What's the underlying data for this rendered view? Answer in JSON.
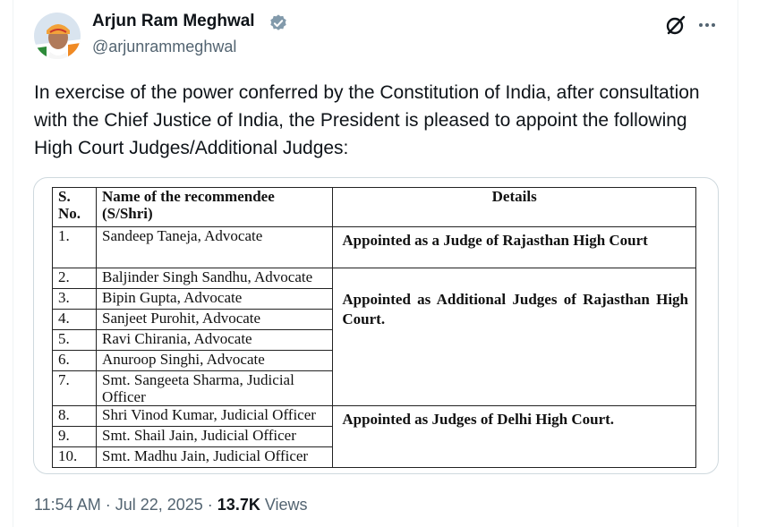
{
  "author": {
    "name": "Arjun Ram Meghwal",
    "handle": "@arjunrammeghwal",
    "verified": true
  },
  "icons": {
    "verified": "verified-badge-icon",
    "grok": "grok-icon",
    "more": "more-horizontal-icon"
  },
  "tweet": {
    "text": "In exercise of the power conferred by the Constitution of India, after consultation with the Chief Justice of India, the President is pleased to appoint the following High Court  Judges/Additional Judges:"
  },
  "document": {
    "headers": {
      "sno_line1": "S.",
      "sno_line2": "No.",
      "name": "Name of the recommendee (S/Shri)",
      "details": "Details"
    },
    "rows": [
      {
        "sno": "1.",
        "name": "Sandeep Taneja, Advocate"
      },
      {
        "sno": "2.",
        "name": "Baljinder Singh Sandhu, Advocate"
      },
      {
        "sno": "3.",
        "name": "Bipin Gupta, Advocate"
      },
      {
        "sno": "4.",
        "name": "Sanjeet Purohit, Advocate"
      },
      {
        "sno": "5.",
        "name": "Ravi Chirania, Advocate"
      },
      {
        "sno": "6.",
        "name": "Anuroop Singhi, Advocate"
      },
      {
        "sno": "7.",
        "name": "Smt. Sangeeta Sharma, Judicial Officer"
      },
      {
        "sno": "8.",
        "name": "Shri Vinod Kumar, Judicial Officer"
      },
      {
        "sno": "9.",
        "name": "Smt. Shail Jain, Judicial Officer"
      },
      {
        "sno": "10.",
        "name": "Smt. Madhu Jain, Judicial Officer"
      }
    ],
    "details": [
      "Appointed as a Judge of Rajasthan High Court",
      "Appointed as Additional Judges of Rajasthan High Court.",
      "Appointed as Judges of Delhi High Court."
    ]
  },
  "meta": {
    "time": "11:54 AM",
    "separator": " · ",
    "date": "Jul 22, 2025",
    "views_count": "13.7K",
    "views_label": " Views"
  },
  "colors": {
    "text": "#0f1419",
    "secondary": "#536471",
    "verified": "#829aab",
    "border": "#cfd9de"
  }
}
